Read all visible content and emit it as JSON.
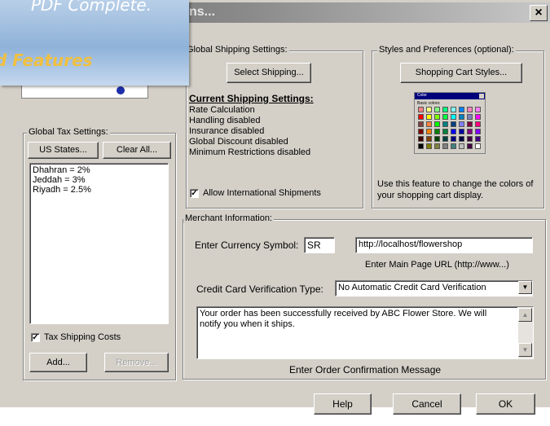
{
  "banner": {
    "line1": "PDF Complete.",
    "line2": "d Features"
  },
  "window": {
    "title_fragment": "ns...",
    "close_glyph": "×"
  },
  "global_shipping": {
    "legend": "Global Shipping Settings:",
    "select_button": "Select Shipping...",
    "current_heading": "Current Shipping Settings:",
    "settings": [
      "Rate Calculation",
      "Handling disabled",
      "Insurance disabled",
      "Global Discount disabled",
      "Minimum Restrictions disabled"
    ],
    "allow_international_label": "Allow International Shipments",
    "allow_international_checked": true
  },
  "styles": {
    "legend": "Styles and Preferences (optional):",
    "button": "Shopping Cart Styles...",
    "palette_title": "Color",
    "palette_subtitle": "Basic colors:",
    "palette_colors": [
      "#ff8080",
      "#ffff80",
      "#80ff80",
      "#00ff80",
      "#80ffff",
      "#0080ff",
      "#ff80c0",
      "#ff80ff",
      "#ff0000",
      "#ffff00",
      "#80ff00",
      "#00ff40",
      "#00ffff",
      "#0080c0",
      "#8080c0",
      "#ff00ff",
      "#804040",
      "#ff8040",
      "#00ff00",
      "#008080",
      "#004080",
      "#8080ff",
      "#800040",
      "#ff0080",
      "#800000",
      "#ff8000",
      "#008000",
      "#008040",
      "#0000ff",
      "#0000a0",
      "#800080",
      "#8000ff",
      "#400000",
      "#804000",
      "#004000",
      "#004040",
      "#000080",
      "#000040",
      "#400040",
      "#400080",
      "#000000",
      "#808000",
      "#808040",
      "#808080",
      "#408080",
      "#c0c0c0",
      "#400040",
      "#ffffff"
    ],
    "description": "Use this feature to change the colors of your shopping cart display."
  },
  "tax": {
    "legend": "Global Tax Settings:",
    "us_states_button": "US States...",
    "clear_all_button": "Clear All...",
    "entries": [
      "Dhahran = 2%",
      "Jeddah = 3%",
      "Riyadh = 2.5%"
    ],
    "tax_shipping_label": "Tax Shipping Costs",
    "tax_shipping_checked": true,
    "add_button": "Add...",
    "remove_button": "Remove..."
  },
  "merchant": {
    "legend": "Merchant Information:",
    "currency_label": "Enter Currency Symbol:",
    "currency_value": "SR",
    "url_value": "http://localhost/flowershop",
    "url_caption": "Enter Main Page URL (http://www...)",
    "cc_label": "Credit Card Verification Type:",
    "cc_value": "No Automatic Credit Card Verification",
    "message_value": "Your order has been successfully received by ABC Flower Store.  We will notify you when it  ships.",
    "message_caption": "Enter Order Confirmation Message"
  },
  "footer": {
    "help": "Help",
    "cancel": "Cancel",
    "ok": "OK"
  }
}
